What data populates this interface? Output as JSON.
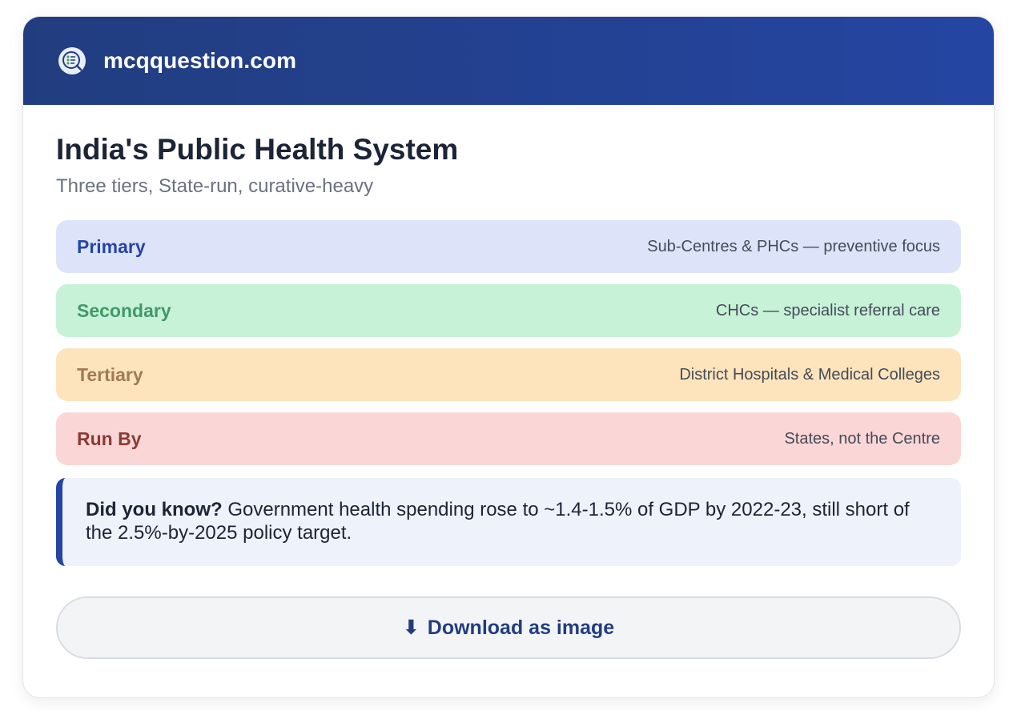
{
  "header": {
    "site_name": "mcqquestion.com",
    "logo_icon": "quiz-checklist-icon",
    "colors": {
      "gradient_start": "#223d7f",
      "gradient_end": "#2445a2"
    }
  },
  "main": {
    "title": "India's Public Health System",
    "subtitle": "Three tiers, State-run, curative-heavy"
  },
  "tiers": [
    {
      "name": "Primary",
      "desc": "Sub-Centres & PHCs — preventive focus",
      "bg": "#dde4fa",
      "fg": "#2445a2"
    },
    {
      "name": "Secondary",
      "desc": "CHCs — specialist referral care",
      "bg": "#c8f2d8",
      "fg": "#3f9a68"
    },
    {
      "name": "Tertiary",
      "desc": "District Hospitals & Medical Colleges",
      "bg": "#fde4bd",
      "fg": "#a07a52"
    },
    {
      "name": "Run By",
      "desc": "States, not the Centre",
      "bg": "#fad6d6",
      "fg": "#8a3a34"
    }
  ],
  "callout": {
    "lead": "Did you know?",
    "text": " Government health spending rose to ~1.4-1.5% of GDP by 2022-23, still short of the 2.5%-by-2025 policy target."
  },
  "download": {
    "icon": "⬇",
    "icon_name": "download-arrow-icon",
    "label": "Download as image"
  }
}
